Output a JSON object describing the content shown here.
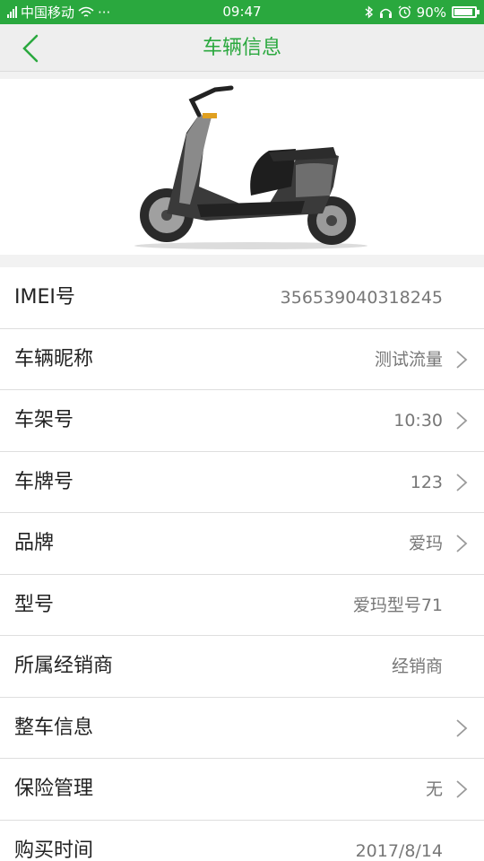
{
  "status_bar": {
    "carrier": "中国移动",
    "time": "09:47",
    "battery": "90%",
    "battery_level": 0.9,
    "dots": "···"
  },
  "nav": {
    "title": "车辆信息"
  },
  "colors": {
    "accent": "#2aa83e"
  },
  "rows": [
    {
      "label": "IMEI号",
      "value": "356539040318245",
      "chevron": false
    },
    {
      "label": "车辆昵称",
      "value": "测试流量",
      "chevron": true
    },
    {
      "label": "车架号",
      "value": "10:30",
      "chevron": true
    },
    {
      "label": "车牌号",
      "value": "123",
      "chevron": true
    },
    {
      "label": "品牌",
      "value": "爱玛",
      "chevron": true
    },
    {
      "label": "型号",
      "value": "爱玛型号71",
      "chevron": false
    },
    {
      "label": "所属经销商",
      "value": "经销商",
      "chevron": false
    },
    {
      "label": "整车信息",
      "value": "",
      "chevron": true
    },
    {
      "label": "保险管理",
      "value": "无",
      "chevron": true
    },
    {
      "label": "购买时间",
      "value": "2017/8/14",
      "chevron": false
    }
  ]
}
